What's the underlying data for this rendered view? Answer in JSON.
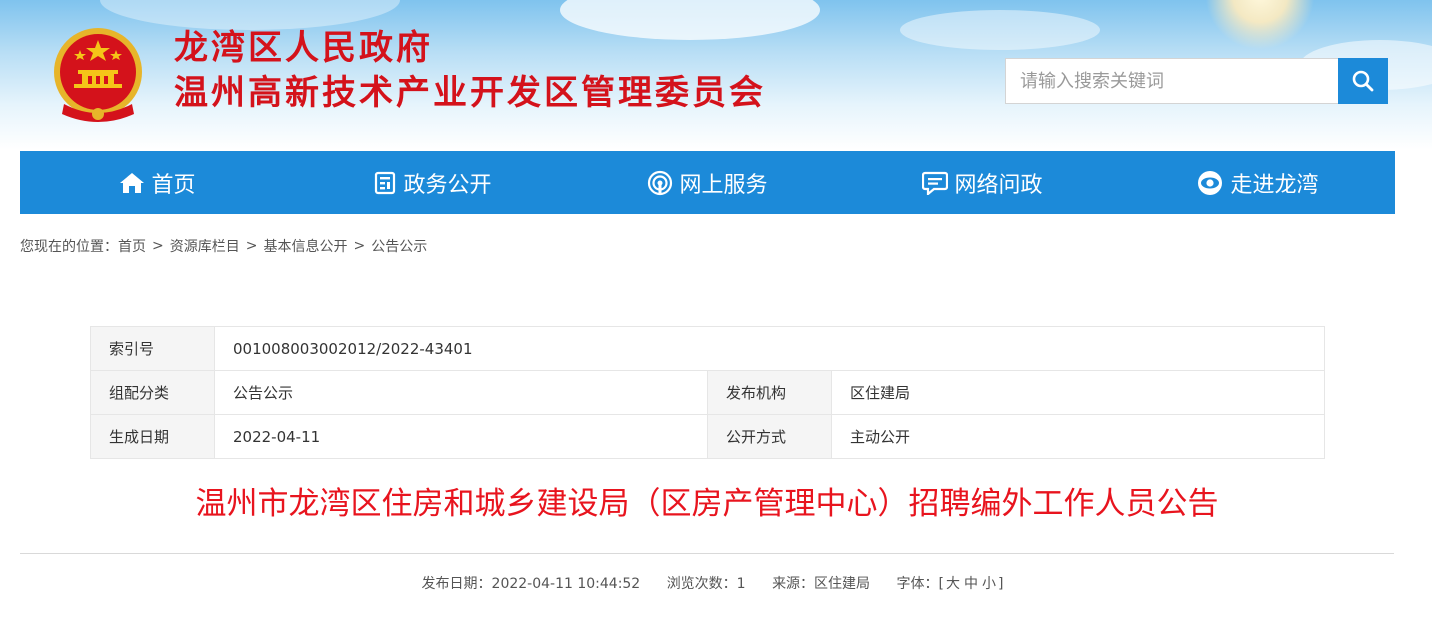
{
  "header": {
    "title_line1": "龙湾区人民政府",
    "title_line2": "温州高新技术产业开发区管理委员会",
    "search_placeholder": "请输入搜索关键词",
    "emblem_icon": "national-emblem-icon"
  },
  "nav": {
    "items": [
      {
        "label": "首页",
        "icon": "home-icon"
      },
      {
        "label": "政务公开",
        "icon": "document-icon"
      },
      {
        "label": "网上服务",
        "icon": "broadcast-icon"
      },
      {
        "label": "网络问政",
        "icon": "chat-icon"
      },
      {
        "label": "走进龙湾",
        "icon": "eye-icon"
      }
    ],
    "color": "#1c8ad9"
  },
  "breadcrumb": {
    "prefix": "您现在的位置：",
    "items": [
      "首页",
      "资源库栏目",
      "基本信息公开",
      "公告公示"
    ],
    "separator": ">"
  },
  "info_table": {
    "index_label": "索引号",
    "index_value": "001008003002012/2022-43401",
    "category_label": "组配分类",
    "category_value": "公告公示",
    "publisher_label": "发布机构",
    "publisher_value": "区住建局",
    "date_label": "生成日期",
    "date_value": "2022-04-11",
    "method_label": "公开方式",
    "method_value": "主动公开"
  },
  "article": {
    "title": "温州市龙湾区住房和城乡建设局（区房产管理中心）招聘编外工作人员公告",
    "title_color": "#e8141e",
    "publish_date": "发布日期：2022-04-11 10:44:52",
    "views": "浏览次数：1",
    "source": "来源：区住建局",
    "font_label": "字体：[",
    "font_large": "大",
    "font_medium": "中",
    "font_small": "小",
    "font_close": "]"
  }
}
